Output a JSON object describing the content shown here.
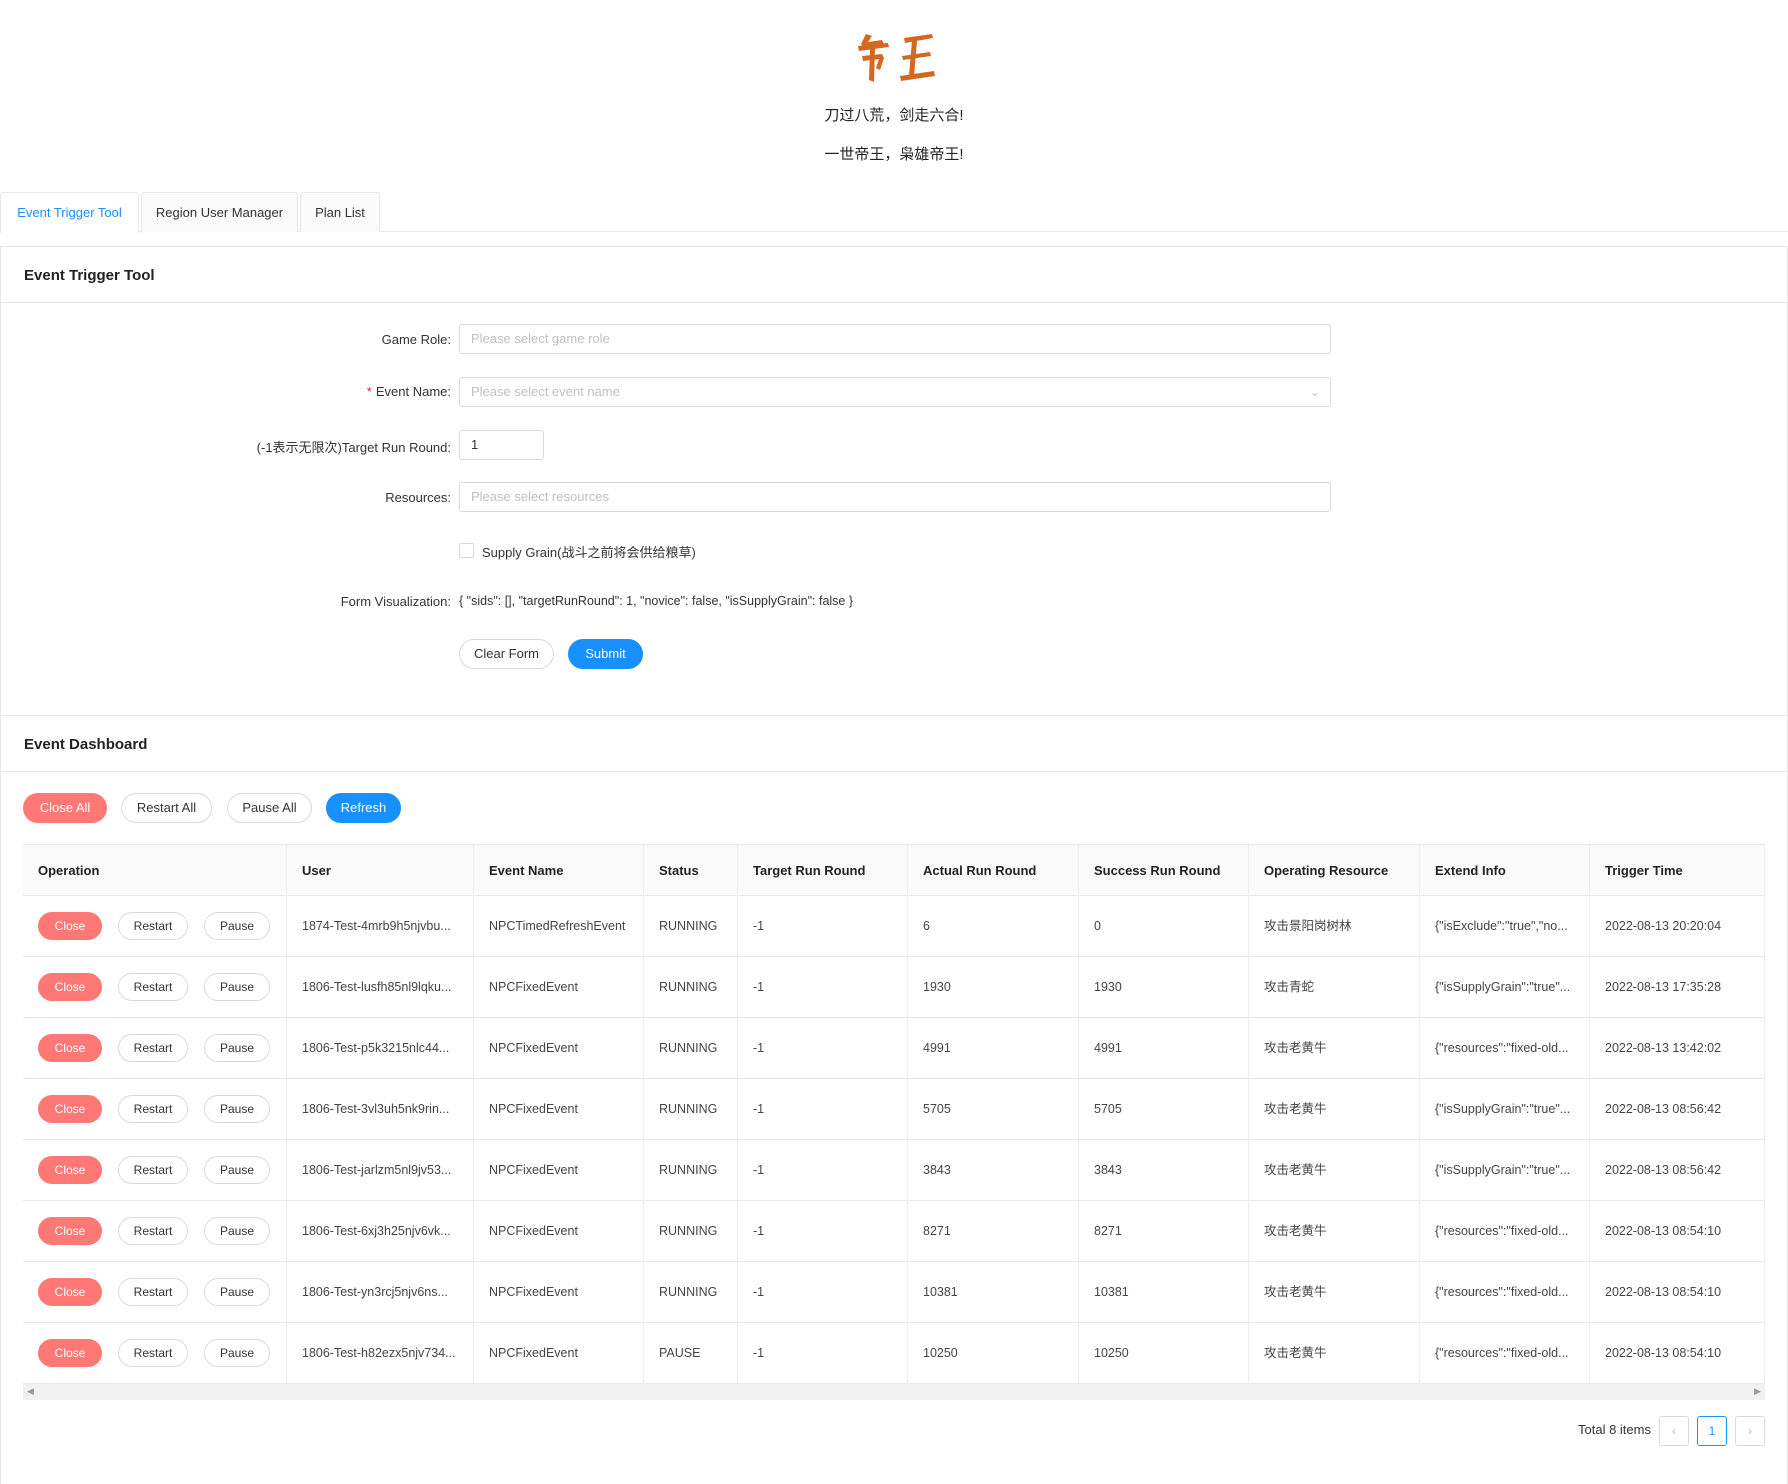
{
  "header": {
    "logo_text": "帝王",
    "slogan1": "刀过八荒，剑走六合!",
    "slogan2": "一世帝王，枭雄帝王!"
  },
  "tabs": [
    {
      "label": "Event Trigger Tool",
      "active": true
    },
    {
      "label": "Region User Manager",
      "active": false
    },
    {
      "label": "Plan List",
      "active": false
    }
  ],
  "trigger_card": {
    "title": "Event Trigger Tool",
    "game_role_label": "Game Role:",
    "game_role_placeholder": "Please select game role",
    "event_name_label": "Event Name:",
    "event_name_placeholder": "Please select event name",
    "target_round_label": "(-1表示无限次)Target Run Round:",
    "target_round_value": "1",
    "resources_label": "Resources:",
    "resources_placeholder": "Please select resources",
    "supply_grain_label": "Supply Grain(战斗之前将会供给粮草)",
    "form_visualization_label": "Form Visualization:",
    "form_visualization_value": "{ \"sids\": [], \"targetRunRound\": 1, \"novice\": false, \"isSupplyGrain\": false }",
    "clear_label": "Clear Form",
    "submit_label": "Submit"
  },
  "dashboard": {
    "title": "Event Dashboard",
    "close_all": "Close All",
    "restart_all": "Restart All",
    "pause_all": "Pause All",
    "refresh": "Refresh",
    "columns": [
      "Operation",
      "User",
      "Event Name",
      "Status",
      "Target Run Round",
      "Actual Run Round",
      "Success Run Round",
      "Operating Resource",
      "Extend Info",
      "Trigger Time"
    ],
    "row_buttons": {
      "close": "Close",
      "restart": "Restart",
      "pause": "Pause"
    },
    "rows": [
      {
        "user": "1874-Test-4mrb9h5njvbu...",
        "event": "NPCTimedRefreshEvent",
        "status": "RUNNING",
        "target": "-1",
        "actual": "6",
        "success": "0",
        "resource": "攻击景阳岗树林",
        "extend": "{\"isExclude\":\"true\",\"no...",
        "time": "2022-08-13 20:20:04"
      },
      {
        "user": "1806-Test-lusfh85nl9lqku...",
        "event": "NPCFixedEvent",
        "status": "RUNNING",
        "target": "-1",
        "actual": "1930",
        "success": "1930",
        "resource": "攻击青蛇",
        "extend": "{\"isSupplyGrain\":\"true\"...",
        "time": "2022-08-13 17:35:28"
      },
      {
        "user": "1806-Test-p5k3215nlc44...",
        "event": "NPCFixedEvent",
        "status": "RUNNING",
        "target": "-1",
        "actual": "4991",
        "success": "4991",
        "resource": "攻击老黄牛",
        "extend": "{\"resources\":\"fixed-old...",
        "time": "2022-08-13 13:42:02"
      },
      {
        "user": "1806-Test-3vl3uh5nk9rin...",
        "event": "NPCFixedEvent",
        "status": "RUNNING",
        "target": "-1",
        "actual": "5705",
        "success": "5705",
        "resource": "攻击老黄牛",
        "extend": "{\"isSupplyGrain\":\"true\"...",
        "time": "2022-08-13 08:56:42"
      },
      {
        "user": "1806-Test-jarlzm5nl9jv53...",
        "event": "NPCFixedEvent",
        "status": "RUNNING",
        "target": "-1",
        "actual": "3843",
        "success": "3843",
        "resource": "攻击老黄牛",
        "extend": "{\"isSupplyGrain\":\"true\"...",
        "time": "2022-08-13 08:56:42"
      },
      {
        "user": "1806-Test-6xj3h25njv6vk...",
        "event": "NPCFixedEvent",
        "status": "RUNNING",
        "target": "-1",
        "actual": "8271",
        "success": "8271",
        "resource": "攻击老黄牛",
        "extend": "{\"resources\":\"fixed-old...",
        "time": "2022-08-13 08:54:10"
      },
      {
        "user": "1806-Test-yn3rcj5njv6ns...",
        "event": "NPCFixedEvent",
        "status": "RUNNING",
        "target": "-1",
        "actual": "10381",
        "success": "10381",
        "resource": "攻击老黄牛",
        "extend": "{\"resources\":\"fixed-old...",
        "time": "2022-08-13 08:54:10"
      },
      {
        "user": "1806-Test-h82ezx5njv734...",
        "event": "NPCFixedEvent",
        "status": "PAUSE",
        "target": "-1",
        "actual": "10250",
        "success": "10250",
        "resource": "攻击老黄牛",
        "extend": "{\"resources\":\"fixed-old...",
        "time": "2022-08-13 08:54:10"
      }
    ]
  },
  "pagination": {
    "total_text": "Total 8 items",
    "current_page": "1"
  },
  "colors": {
    "primary": "#1890ff",
    "danger": "#ff7875",
    "logo": "#d4681e"
  }
}
